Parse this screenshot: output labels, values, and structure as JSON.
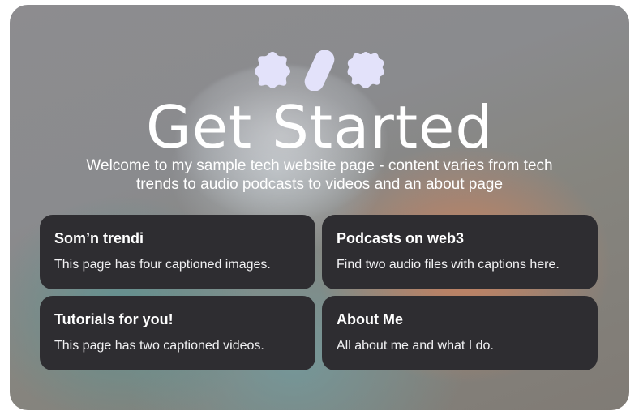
{
  "hero": {
    "title": "Get Started",
    "subtitle": "Welcome  to my sample tech website page - content varies from tech trends to audio podcasts to videos and an about page",
    "icon_color": "#e3e2fa"
  },
  "nav_cards": [
    {
      "title": "Som’n trendi",
      "description": "This page has four captioned images."
    },
    {
      "title": "Podcasts on web3",
      "description": "Find two audio files with captions here."
    },
    {
      "title": "Tutorials for you!",
      "description": "This page has two captioned videos."
    },
    {
      "title": "About Me",
      "description": "All about me and what I do."
    }
  ],
  "colors": {
    "card_bg": "#2e2d31",
    "text": "#ffffff"
  }
}
